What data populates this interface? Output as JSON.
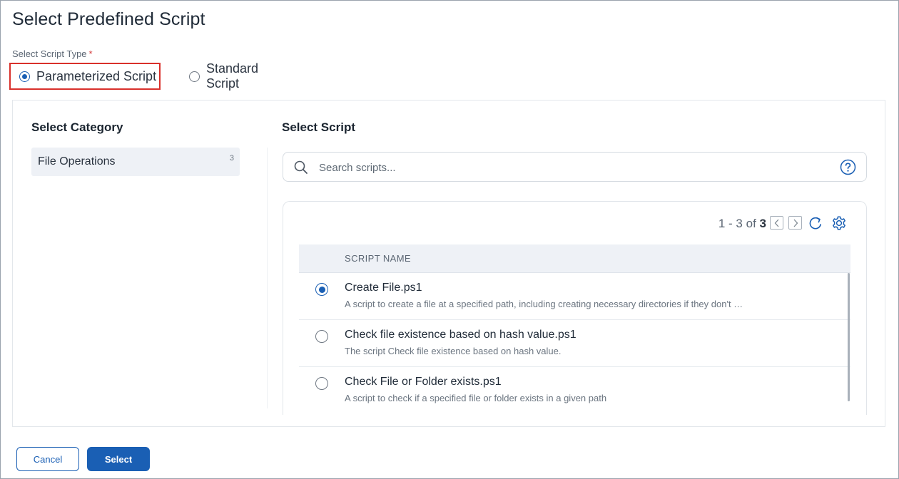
{
  "dialog": {
    "title": "Select Predefined Script"
  },
  "script_type": {
    "label": "Select Script Type",
    "required_mark": "*",
    "options": [
      {
        "label": "Parameterized Script",
        "selected": true
      },
      {
        "label": "Standard Script",
        "selected": false
      }
    ]
  },
  "category": {
    "heading": "Select Category",
    "items": [
      {
        "name": "File Operations",
        "count": "3"
      }
    ]
  },
  "script": {
    "heading": "Select Script",
    "search_placeholder": "Search scripts...",
    "help_icon": "question-circle-icon",
    "pager": {
      "range": "1 - 3 of",
      "total": "3"
    },
    "column_header": "SCRIPT NAME",
    "rows": [
      {
        "name": "Create File.ps1",
        "description": "A script to create a file at a specified path, including creating necessary directories if they don't …",
        "selected": true
      },
      {
        "name": "Check file existence based on hash value.ps1",
        "description": "The script Check file existence based on hash value.",
        "selected": false
      },
      {
        "name": "Check File or Folder exists.ps1",
        "description": "A script to check if a specified file or folder exists in a given path",
        "selected": false
      }
    ]
  },
  "footer": {
    "cancel_label": "Cancel",
    "select_label": "Select"
  },
  "colors": {
    "accent": "#1a5fb4",
    "highlight_border": "#d9302b"
  }
}
